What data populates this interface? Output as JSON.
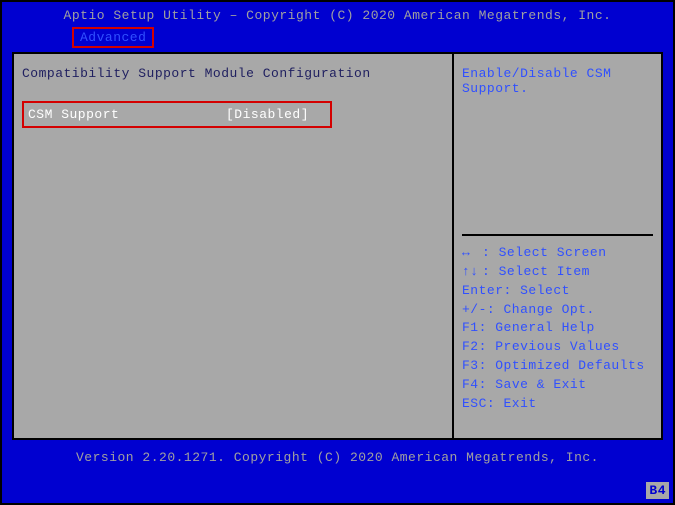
{
  "header": {
    "title": "Aptio Setup Utility – Copyright (C) 2020 American Megatrends, Inc.",
    "tab": "Advanced"
  },
  "left": {
    "section_title": "Compatibility Support Module Configuration",
    "setting_label": "CSM Support",
    "setting_value": "[Disabled]"
  },
  "right": {
    "help": "Enable/Disable CSM Support.",
    "hints": [
      {
        "key": "↔",
        "label": ": Select Screen"
      },
      {
        "key": "↑↓",
        "label": ": Select Item"
      },
      {
        "key": "Enter",
        "label": ": Select"
      },
      {
        "key": "+/-",
        "label": ": Change Opt."
      },
      {
        "key": "F1",
        "label": ": General Help"
      },
      {
        "key": "F2",
        "label": ": Previous Values"
      },
      {
        "key": "F3",
        "label": ": Optimized Defaults"
      },
      {
        "key": "F4",
        "label": ": Save & Exit"
      },
      {
        "key": "ESC",
        "label": ": Exit"
      }
    ]
  },
  "footer": {
    "version": "Version 2.20.1271. Copyright (C) 2020 American Megatrends, Inc."
  },
  "badge": "B4"
}
